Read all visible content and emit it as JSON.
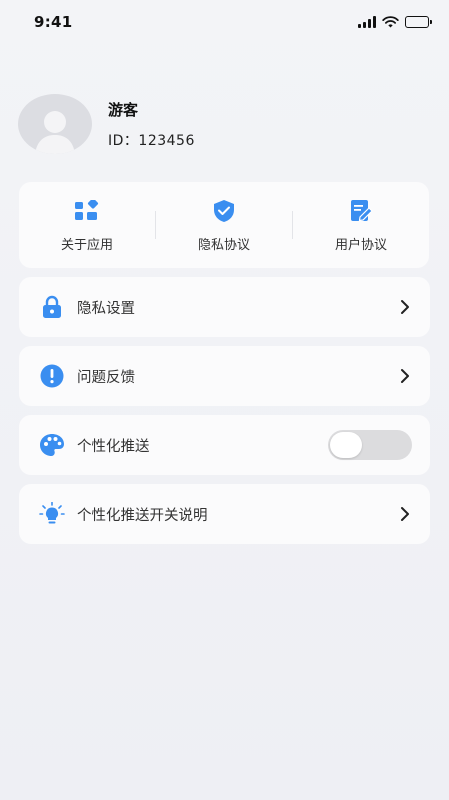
{
  "status_bar": {
    "time": "9:41"
  },
  "profile": {
    "nickname": "游客",
    "id_text": "ID：123456"
  },
  "quick_actions": [
    {
      "label": "关于应用",
      "icon": "apps-icon"
    },
    {
      "label": "隐私协议",
      "icon": "shield-check-icon"
    },
    {
      "label": "用户协议",
      "icon": "document-edit-icon"
    }
  ],
  "menu": {
    "privacy_settings": {
      "label": "隐私设置",
      "icon": "lock-icon"
    },
    "feedback": {
      "label": "问题反馈",
      "icon": "exclamation-icon"
    },
    "personalized_push": {
      "label": "个性化推送",
      "icon": "palette-icon",
      "enabled": false
    },
    "push_explanation": {
      "label": "个性化推送开关说明",
      "icon": "lightbulb-icon"
    }
  },
  "colors": {
    "accent": "#3a8ef0",
    "background": "#f1f2f6",
    "card": "#fbfbfc"
  }
}
